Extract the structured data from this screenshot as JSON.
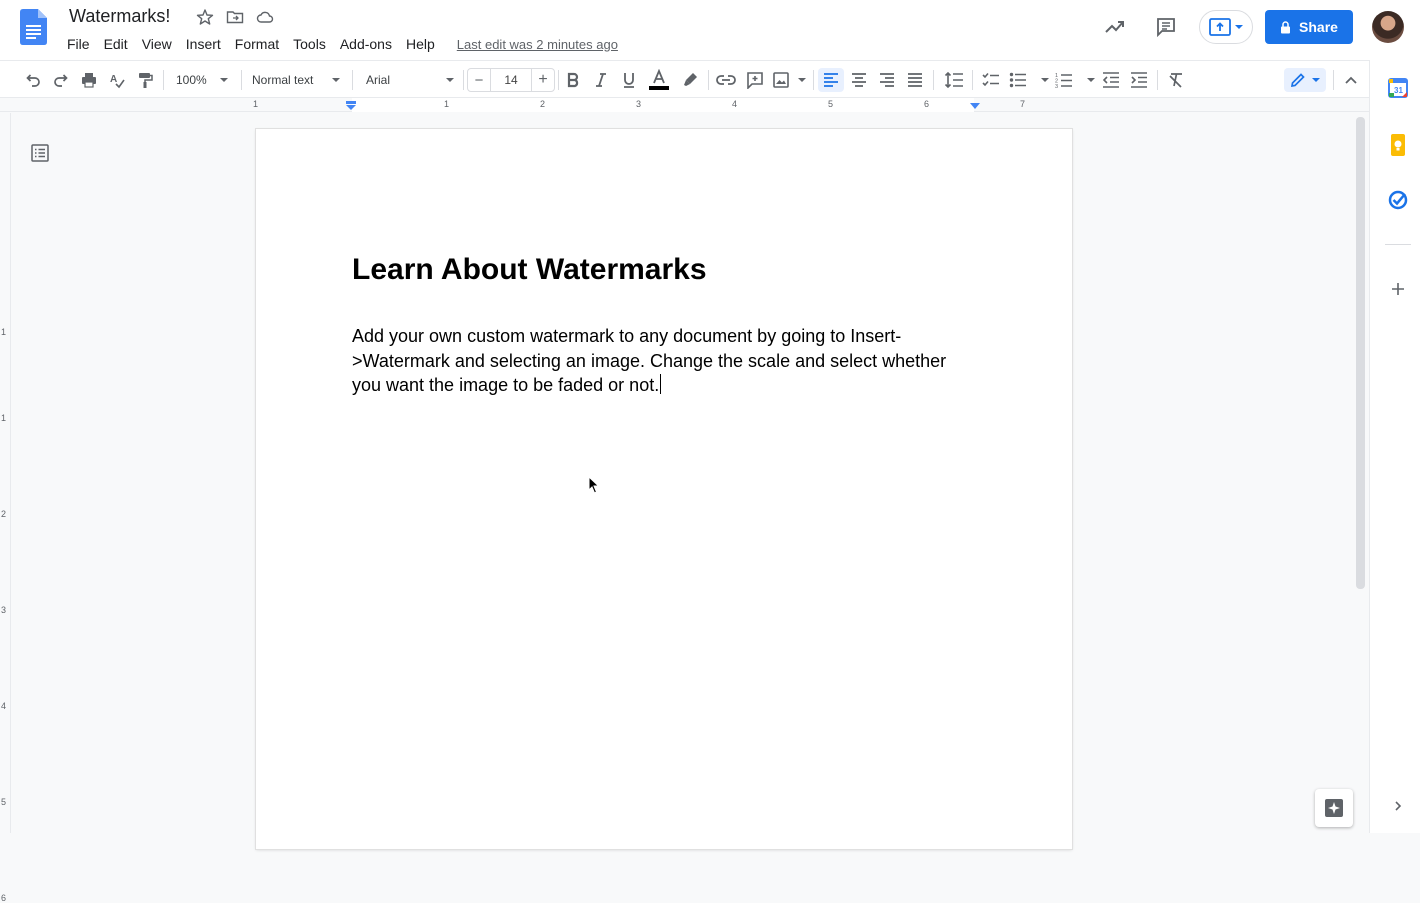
{
  "document": {
    "title": "Watermarks!",
    "heading": "Learn About Watermarks",
    "body": "Add your own custom watermark to any document by going to Insert->Watermark and selecting an image. Change the scale and select whether you want the image to be faded or not."
  },
  "menu": {
    "items": [
      "File",
      "Edit",
      "View",
      "Insert",
      "Format",
      "Tools",
      "Add-ons",
      "Help"
    ],
    "last_edit": "Last edit was 2 minutes ago"
  },
  "header": {
    "share_label": "Share"
  },
  "toolbar": {
    "zoom": "100%",
    "style": "Normal text",
    "font": "Arial",
    "font_size": "14",
    "minus": "−",
    "plus": "+"
  },
  "ruler": {
    "numbers": [
      "1",
      "1",
      "2",
      "3",
      "4",
      "5",
      "6",
      "7"
    ]
  },
  "vruler": {
    "numbers": [
      "1",
      "1",
      "2",
      "3",
      "4",
      "5",
      "6"
    ]
  },
  "colors": {
    "accent": "#1a73e8",
    "text_color_bar": "#000000"
  },
  "icons": {
    "undo": "undo-icon",
    "redo": "redo-icon",
    "print": "print-icon",
    "spellcheck": "spellcheck-icon",
    "paint_format": "paint-format-icon",
    "bold": "bold-icon",
    "italic": "italic-icon",
    "underline": "underline-icon"
  }
}
